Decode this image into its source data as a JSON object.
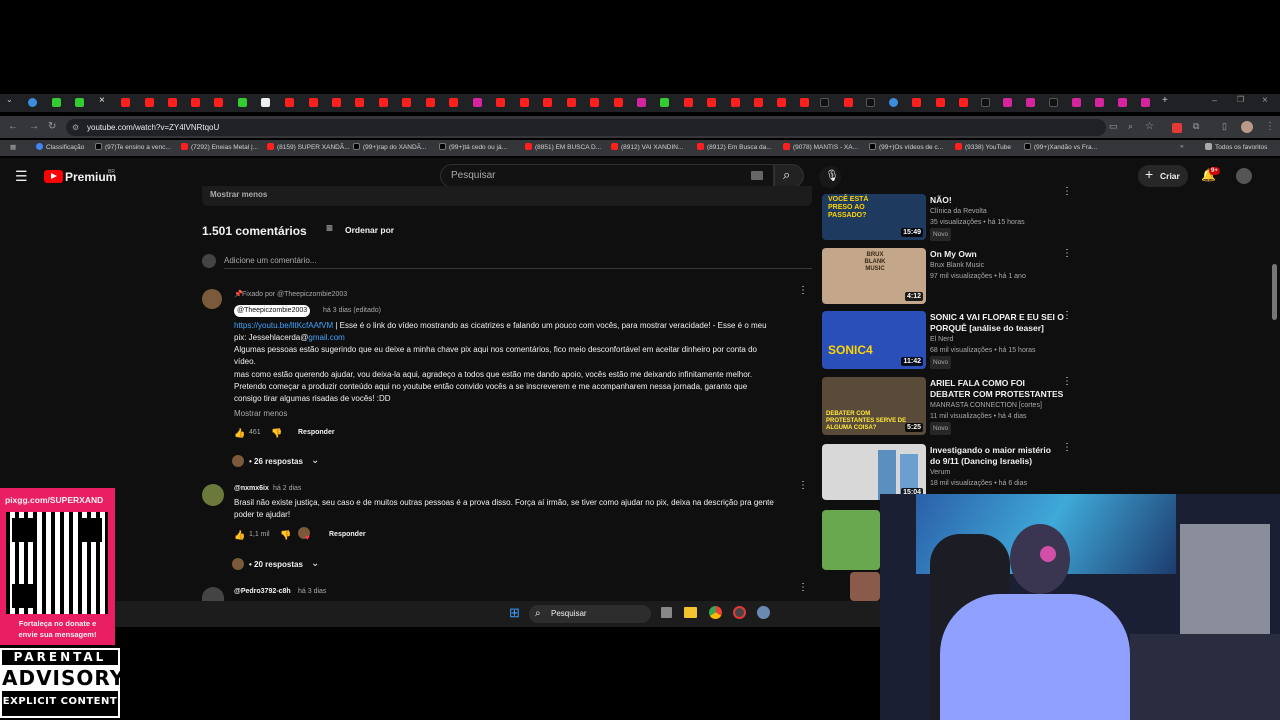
{
  "browser": {
    "url": "youtube.com/watch?v=ZY4lVNRtqoU",
    "bookmarks": [
      "Classificação",
      "(97)Te ensino a venc...",
      "(7292) Eneias Metal |...",
      "(8159) SUPER XANDÃ...",
      "(99+)rap do XANDÃ...",
      "(99+)tá cedo ou já...",
      "(8851) EM BUSCA D...",
      "(8912) VAI XANDIN...",
      "(8912) Em Busca da...",
      "(9078) MANTIS - XA...",
      "(99+)Os vídeos de c...",
      "(9338) YouTube",
      "(99+)Xandão vs Fra..."
    ],
    "all_bookmarks": "Todos os favoritos"
  },
  "youtube": {
    "logo_text": "Premium",
    "region": "BR",
    "search_placeholder": "Pesquisar",
    "create_label": "Criar",
    "notif_count": "9+",
    "show_less_top": "Mostrar menos",
    "comment_count": "1.501 comentários",
    "sort_label": "Ordenar por",
    "add_comment": "Adicione um comentário...",
    "comments": [
      {
        "pinned": "Fixado por @Theepiczombie2003",
        "author": "@Theepiczombie2003",
        "time": "há 3 dias (editado)",
        "link": "https://youtu.be/lltKcfAAfVM",
        "line1": " | Esse é o link do vídeo mostrando as cicatrizes e falando um pouco com vocês, para mostrar veracidade! - Esse é o meu",
        "pix_prefix": "pix: Jessehlacerda@",
        "pix_link": "gmail.com",
        "line3": "Algumas pessoas estão sugerindo que eu deixe a minha chave pix aqui nos comentários, fico meio desconfortável em aceitar dinheiro por conta do",
        "line4": "vídeo.",
        "line5": "mas como estão querendo ajudar, vou deixa-la aqui, agradeço a todos que estão me dando apoio, vocês estão me deixando infinitamente melhor.",
        "line6": "Pretendo começar a produzir conteúdo aqui no youtube então convido vocês a se inscreverem e me acompanharem nessa jornada, garanto que",
        "line7": "consigo tirar algumas risadas de vocês! :DD",
        "show_less": "Mostrar menos",
        "likes": "461",
        "reply": "Responder",
        "replies": "• 26 respostas"
      },
      {
        "author": "@nxmx6ix",
        "time": "há 2 dias",
        "line1": "Brasil não existe justiça, seu caso e de muitos outras pessoas é a prova disso. Força aí irmão, se tiver como ajudar no pix, deixa na descrição pra gente",
        "line2": "poder te ajudar!",
        "likes": "1,1 mil",
        "reply": "Responder",
        "replies": "• 20 respostas"
      },
      {
        "author": "@Pedro3792-c8h",
        "time": "há 3 dias"
      }
    ],
    "related": [
      {
        "title1": "NÃO!",
        "title2": "",
        "channel": "Clínica da Revolta",
        "meta": "35 visualizações • há 15 horas",
        "badge": "Novo",
        "duration": "15:49",
        "thumb_text": "VOCÊ ESTÁ PRESO AO PASSADO?"
      },
      {
        "title1": "On My Own",
        "title2": "",
        "channel": "Brux Blank Music",
        "meta": "97 mil visualizações • há 1 ano",
        "badge": "",
        "duration": "4:12",
        "thumb_text": "BRUX BLANK MUSIC"
      },
      {
        "title1": "SONIC 4 VAI FLOPAR E EU SEI O",
        "title2": "PORQUÊ [análise do teaser]",
        "channel": "El Nerd",
        "meta": "68 mil visualizações • há 15 horas",
        "badge": "Novo",
        "duration": "11:42",
        "thumb_text": "SONIC4"
      },
      {
        "title1": "ARIEL FALA COMO FOI",
        "title2": "DEBATER COM PROTESTANTES",
        "channel": "MANRASTA CONNECTION [cortes]",
        "meta": "11 mil visualizações • há 4 dias",
        "badge": "Novo",
        "duration": "5:25",
        "thumb_text": "DEBATER COM PROTESTANTES SERVE DE ALGUMA COISA?"
      },
      {
        "title1": "Investigando o maior mistério",
        "title2": "do 9/11 (Dancing Israelis)",
        "channel": "Verum",
        "meta": "18 mil visualizações • há 6 dias",
        "badge": "",
        "duration": "15:04",
        "thumb_text": ""
      }
    ]
  },
  "taskbar": {
    "search_placeholder": "Pesquisar"
  },
  "overlay": {
    "donate_url": "pixgg.com/SUPERXAND",
    "donate_text1": "Fortaleça no donate e",
    "donate_text2": "envie sua mensagem!",
    "pa1": "PARENTAL",
    "pa2": "ADVISORY",
    "pa3": "EXPLICIT CONTENT"
  },
  "colors": {
    "yt_red": "#ff0000",
    "link": "#3ea6ff",
    "donate": "#e91e63"
  }
}
